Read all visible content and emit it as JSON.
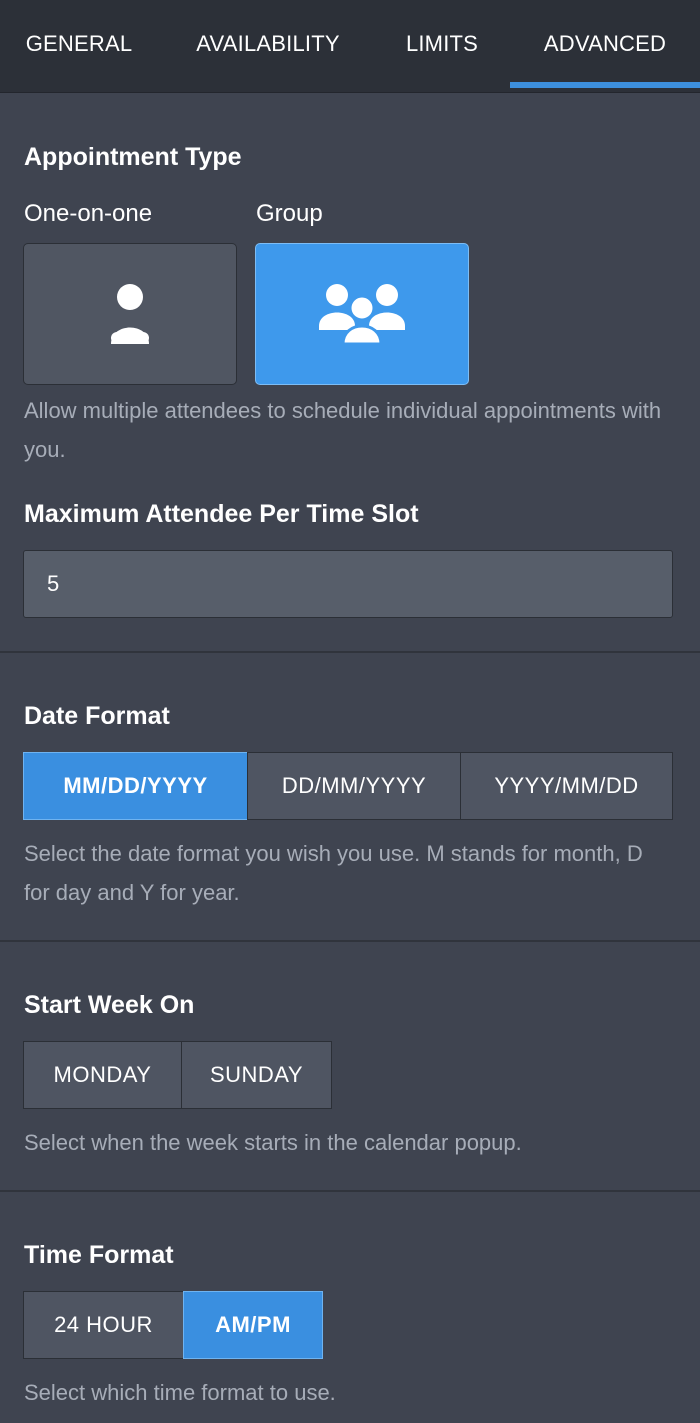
{
  "tabs": [
    {
      "label": "GENERAL"
    },
    {
      "label": "AVAILABILITY"
    },
    {
      "label": "LIMITS"
    },
    {
      "label": "ADVANCED",
      "active": true
    }
  ],
  "appointment_type": {
    "title": "Appointment Type",
    "options": [
      {
        "label": "One-on-one",
        "icon": "person-icon",
        "selected": false
      },
      {
        "label": "Group",
        "icon": "group-icon",
        "selected": true
      }
    ],
    "help": "Allow multiple attendees to schedule individual appointments with you."
  },
  "max_attendee": {
    "title": "Maximum Attendee Per Time Slot",
    "value": "5"
  },
  "date_format": {
    "title": "Date Format",
    "options": [
      {
        "label": "MM/DD/YYYY",
        "selected": true
      },
      {
        "label": "DD/MM/YYYY",
        "selected": false
      },
      {
        "label": "YYYY/MM/DD",
        "selected": false
      }
    ],
    "help": "Select the date format you wish you use. M stands for month, D for day and Y for year."
  },
  "start_week": {
    "title": "Start Week On",
    "options": [
      {
        "label": "MONDAY",
        "selected": false
      },
      {
        "label": "SUNDAY",
        "selected": false
      }
    ],
    "help": "Select when the week starts in the calendar popup."
  },
  "time_format": {
    "title": "Time Format",
    "options": [
      {
        "label": "24 HOUR",
        "selected": false
      },
      {
        "label": "AM/PM",
        "selected": true
      }
    ],
    "help": "Select which time format to use."
  },
  "colors": {
    "accent": "#3d8fdc",
    "background": "#3f4450",
    "tab_bar": "#2c3038",
    "help_text": "#a7adb8"
  }
}
